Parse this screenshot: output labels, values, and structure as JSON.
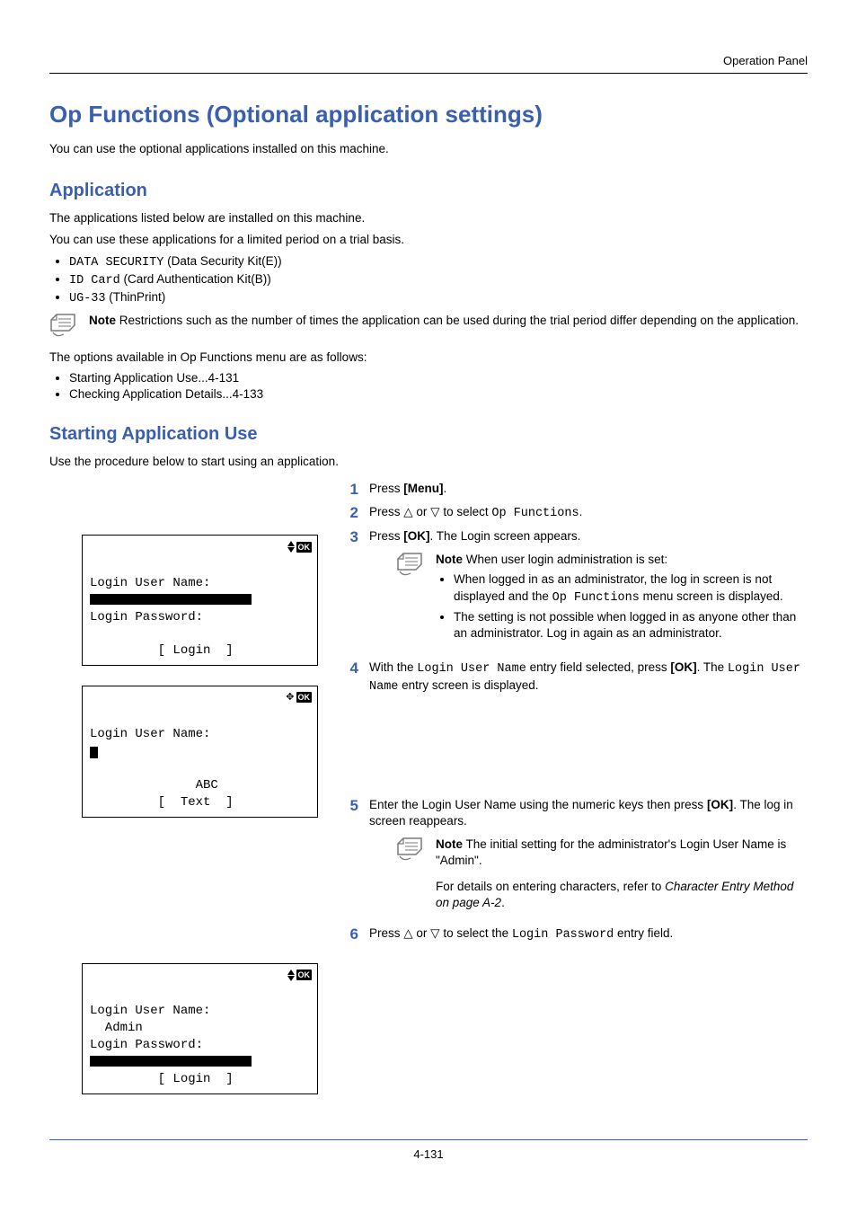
{
  "running_head": "Operation Panel",
  "h1": "Op Functions (Optional application settings)",
  "intro_para": "You can use the optional applications installed on this machine.",
  "app_heading": "Application",
  "app_para1": "The applications listed below are installed on this machine.",
  "app_para2": "You can use these applications for a limited period on a trial basis.",
  "apps": [
    {
      "code": "DATA SECURITY",
      "desc": " (Data Security Kit(E))"
    },
    {
      "code": "ID Card",
      "desc": " (Card Authentication Kit(B))"
    },
    {
      "code": "UG-33",
      "desc": " (ThinPrint)"
    }
  ],
  "note1_label": "Note",
  "note1_text": "  Restrictions such as the number of times the application can be used during the trial period differ depending on the application.",
  "opt_para": "The options available in Op Functions menu are as follows:",
  "opts": [
    "Starting Application Use...4-131",
    "Checking Application Details...4-133"
  ],
  "start_heading": "Starting Application Use",
  "start_para": "Use the procedure below to start using an application.",
  "step1_pre": "Press ",
  "step1_menu": "[Menu]",
  "step1_post": ".",
  "step2_pre": "Press ",
  "step2_mid": " or ",
  "step2_post1": " to select ",
  "step2_fn": "Op Functions",
  "step2_post2": ".",
  "step3_pre": "Press ",
  "step3_ok": "[OK]",
  "step3_post": ". The Login screen appears.",
  "note2_label": "Note",
  "note2_lead": "  When user login administration is set:",
  "note2_b1_a": "When logged in as an administrator, the log in screen is not displayed and the ",
  "note2_b1_code": "Op Functions",
  "note2_b1_b": " menu screen is displayed.",
  "note2_b2": "The setting is not possible when logged in as anyone other than an administrator. Log in again as an administrator.",
  "step4_pre": "With the ",
  "step4_code1": "Login User Name",
  "step4_mid": " entry field selected, press ",
  "step4_ok": "[OK]",
  "step4_mid2": ". The ",
  "step4_code2": "Login User Name",
  "step4_post": " entry screen is displayed.",
  "step5_pre": "Enter the Login User Name using the numeric keys then press ",
  "step5_ok": "[OK]",
  "step5_post": ". The log in screen reappears.",
  "note3_label": "Note",
  "note3_text": "  The initial setting for the administrator's Login User Name is \"Admin\".",
  "note3_extra_a": "For details on entering characters, refer to ",
  "note3_extra_i": "Character Entry Method on page A-2",
  "note3_extra_b": ".",
  "step6_pre": "Press ",
  "step6_mid": " or ",
  "step6_post1": " to select the ",
  "step6_code": "Login Password",
  "step6_post2": " entry field.",
  "lcd1": {
    "l1": "Login User Name:",
    "l3": "Login Password:",
    "l5": "         [ Login  ]"
  },
  "lcd2": {
    "l1": "Login User Name:",
    "l3": "              ABC",
    "l4": "         [  Text  ]"
  },
  "lcd3": {
    "l1": "Login User Name:",
    "l2": "  Admin",
    "l3": "Login Password:",
    "l5": "         [ Login  ]"
  },
  "page_num": "4-131"
}
